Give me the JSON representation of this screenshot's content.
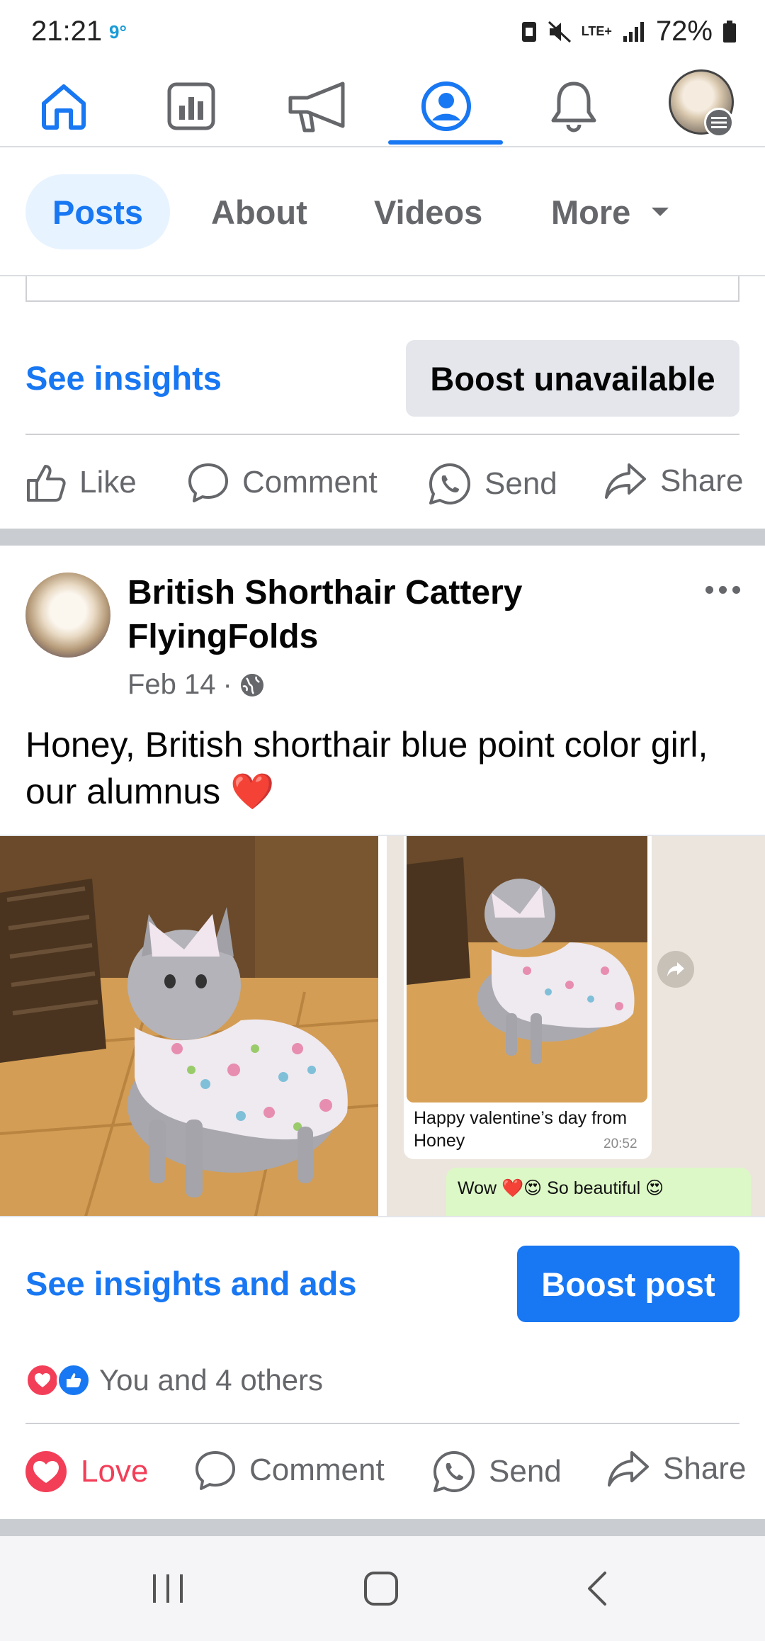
{
  "status_bar": {
    "time": "21:21",
    "temp": "9°",
    "network": "LTE+",
    "battery": "72%"
  },
  "top_nav": {
    "items": [
      "home-icon",
      "insights-icon",
      "ads-megaphone-icon",
      "profile-icon",
      "bell-icon",
      "menu-avatar"
    ],
    "active": "profile-icon"
  },
  "tabs": [
    {
      "label": "Posts",
      "active": true
    },
    {
      "label": "About"
    },
    {
      "label": "Videos"
    },
    {
      "label": "More"
    }
  ],
  "prev_post": {
    "insights_label": "See insights",
    "boost_label": "Boost unavailable",
    "actions": [
      "Like",
      "Comment",
      "Send",
      "Share"
    ]
  },
  "post": {
    "author": "British Shorthair Cattery FlyingFolds",
    "date": "Feb 14",
    "text": "Honey, British shorthair blue point color girl, our alumnus ❤️",
    "chat": {
      "caption": "Happy valentine’s day from Honey",
      "time": "20:52",
      "reply": "Wow ❤️😍 So beautiful 😍"
    },
    "insights_label": "See insights and ads",
    "boost_label": "Boost post",
    "reactions_text": "You and 4 others",
    "actions": [
      "Love",
      "Comment",
      "Send",
      "Share"
    ]
  },
  "colors": {
    "accent": "#1877f2",
    "love": "#f33e58",
    "muted": "#65676b"
  }
}
